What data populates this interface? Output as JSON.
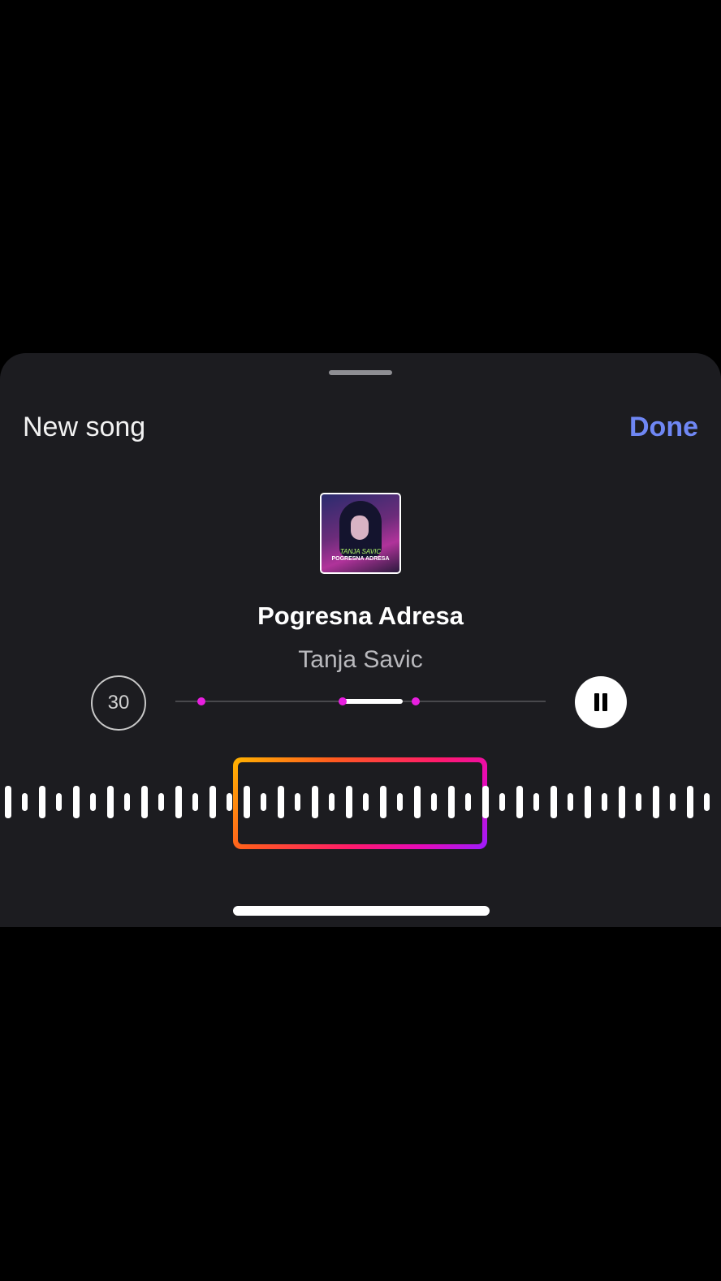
{
  "sheet": {
    "title": "New song",
    "done_label": "Done"
  },
  "album_art": {
    "artist_text": "TANJA SAVIC",
    "title_text": "POGRESNA ADRESA"
  },
  "song": {
    "title": "Pogresna Adresa",
    "artist": "Tanja Savic"
  },
  "controls": {
    "duration_label": "30",
    "play_state": "playing"
  },
  "colors": {
    "accent": "#6f87f4",
    "marker": "#e81fdf",
    "frame_gradient": [
      "#ffb400",
      "#ff5a1f",
      "#ff1a6b",
      "#e60ab8",
      "#9b1cff"
    ]
  }
}
